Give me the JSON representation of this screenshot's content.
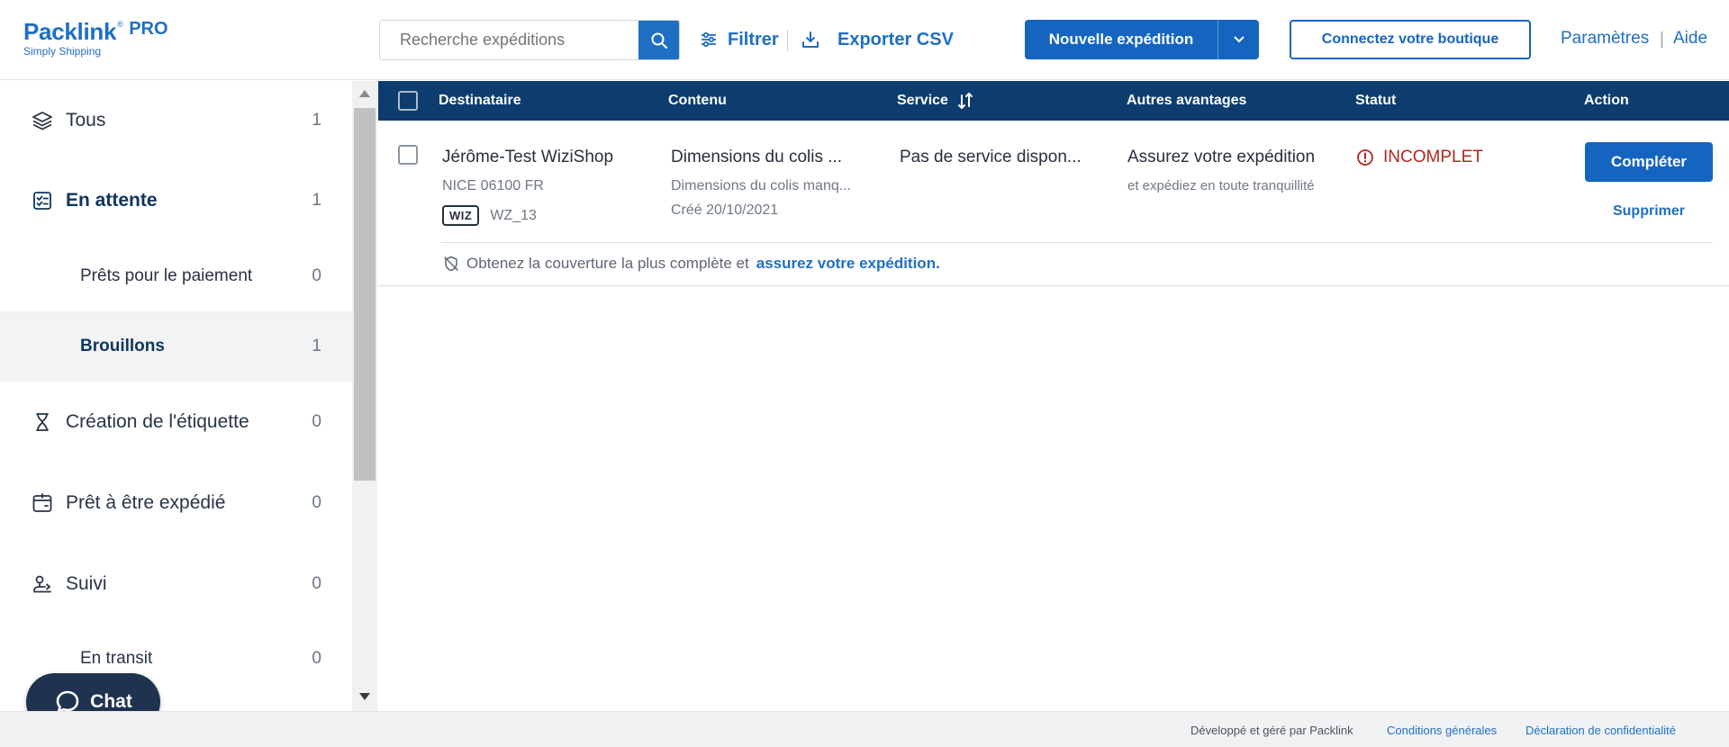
{
  "header": {
    "logo": {
      "name": "Packlink",
      "reg": "®",
      "tier": "PRO",
      "tagline": "Simply Shipping"
    },
    "search": {
      "placeholder": "Recherche expéditions",
      "value": ""
    },
    "filter_label": "Filtrer",
    "export_label": "Exporter CSV",
    "new_shipment_label": "Nouvelle expédition",
    "connect_label": "Connectez votre boutique",
    "settings_label": "Paramètres",
    "separator": "|",
    "help_label": "Aide"
  },
  "sidebar": {
    "items": [
      {
        "label": "Tous",
        "count": "1",
        "icon": "layers-icon"
      },
      {
        "label": "En attente",
        "count": "1",
        "icon": "checklist-icon"
      },
      {
        "label": "Prêts pour le paiement",
        "count": "0"
      },
      {
        "label": "Brouillons",
        "count": "1"
      },
      {
        "label": "Création de l'étiquette",
        "count": "0",
        "icon": "hourglass-icon"
      },
      {
        "label": "Prêt à être expédié",
        "count": "0",
        "icon": "box-icon"
      },
      {
        "label": "Suivi",
        "count": "0",
        "icon": "tracking-icon"
      },
      {
        "label": "En transit",
        "count": "0"
      }
    ]
  },
  "chat": {
    "label": "Chat"
  },
  "table": {
    "columns": [
      "Destinataire",
      "Contenu",
      "Service",
      "Autres avantages",
      "Statut",
      "Action"
    ],
    "rows": [
      {
        "recipient": "Jérôme-Test WiziShop",
        "address": "NICE 06100 FR",
        "badge": "WIZ",
        "reference": "WZ_13",
        "content_title": "Dimensions du colis ...",
        "content_sub": "Dimensions du colis manq...",
        "created": "Créé 20/10/2021",
        "service": "Pas de service dispon...",
        "benefit_title": "Assurez votre expédition",
        "benefit_sub": "et expédiez en toute tranquillité",
        "status": "INCOMPLET",
        "action_primary": "Compléter",
        "action_secondary": "Supprimer",
        "coverage_text": "Obtenez la couverture la plus complète et",
        "coverage_link": "assurez votre expédition."
      }
    ]
  },
  "footer": {
    "credit": "Développé et géré par Packlink",
    "terms": "Conditions générales",
    "privacy": "Déclaration de confidentialité"
  },
  "colors": {
    "brand": "#1f6fc4",
    "primary_button": "#1565c0",
    "table_header": "#0c3d6e",
    "status_error": "#b3261e",
    "chat_bg": "#1f3350"
  }
}
